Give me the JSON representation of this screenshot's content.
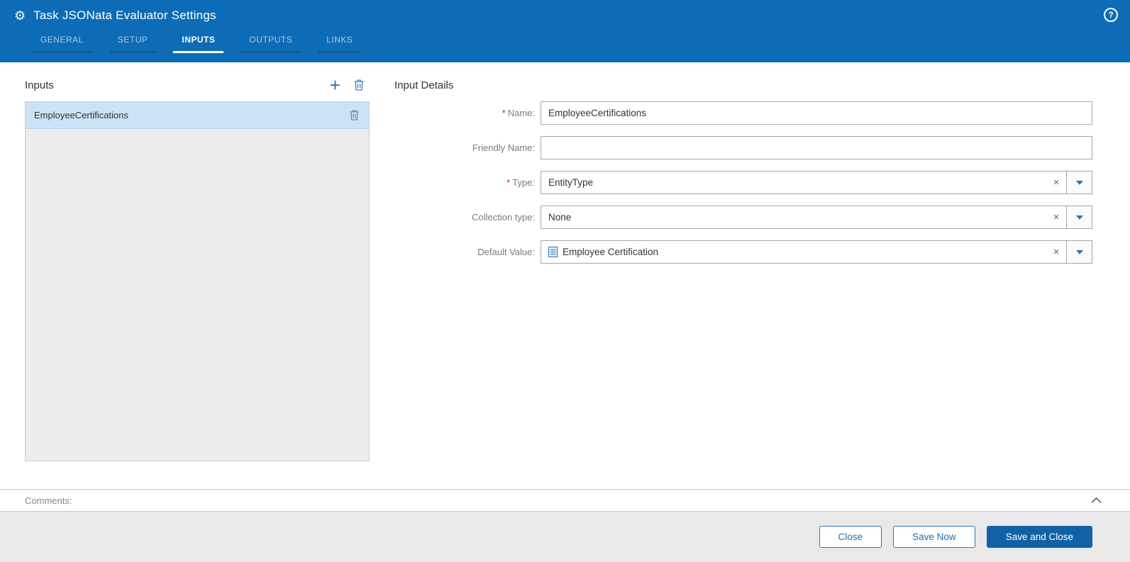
{
  "header": {
    "title": "Task JSONata Evaluator Settings",
    "tabs": [
      {
        "label": "GENERAL",
        "active": false
      },
      {
        "label": "SETUP",
        "active": false
      },
      {
        "label": "INPUTS",
        "active": true
      },
      {
        "label": "OUTPUTS",
        "active": false
      },
      {
        "label": "LINKS",
        "active": false
      }
    ]
  },
  "inputs_panel": {
    "title": "Inputs",
    "items": [
      {
        "label": "EmployeeCertifications",
        "selected": true
      }
    ]
  },
  "details": {
    "title": "Input Details",
    "fields": {
      "name": {
        "label": "Name:",
        "marker": "*",
        "value": "EmployeeCertifications"
      },
      "friendly_name": {
        "label": "Friendly Name:",
        "marker": "",
        "value": ""
      },
      "type": {
        "label": "Type:",
        "marker": "*",
        "value": "EntityType"
      },
      "collection_type": {
        "label": "Collection type:",
        "marker": "",
        "value": "None"
      },
      "default_value": {
        "label": "Default Value:",
        "marker": "",
        "value": "Employee Certification"
      }
    }
  },
  "comments": {
    "label": "Comments:"
  },
  "footer": {
    "buttons": [
      {
        "label": "Close",
        "primary": false
      },
      {
        "label": "Save Now",
        "primary": false
      },
      {
        "label": "Save and Close",
        "primary": true
      }
    ]
  },
  "icons": {
    "gear": "⚙",
    "help": "?",
    "add": "+",
    "clear": "×"
  },
  "colors": {
    "header_bg": "#0e6cb6",
    "active_tab": "#ffffff",
    "inactive_tab_text": "#a9c9e4",
    "selected_row_bg": "#cbe3f7",
    "list_bg": "#ececec",
    "accent_blue": "#2a76b9",
    "primary_button_bg": "#1261a7",
    "required_red": "#cc2222",
    "footer_bg": "#e9e9e9"
  }
}
